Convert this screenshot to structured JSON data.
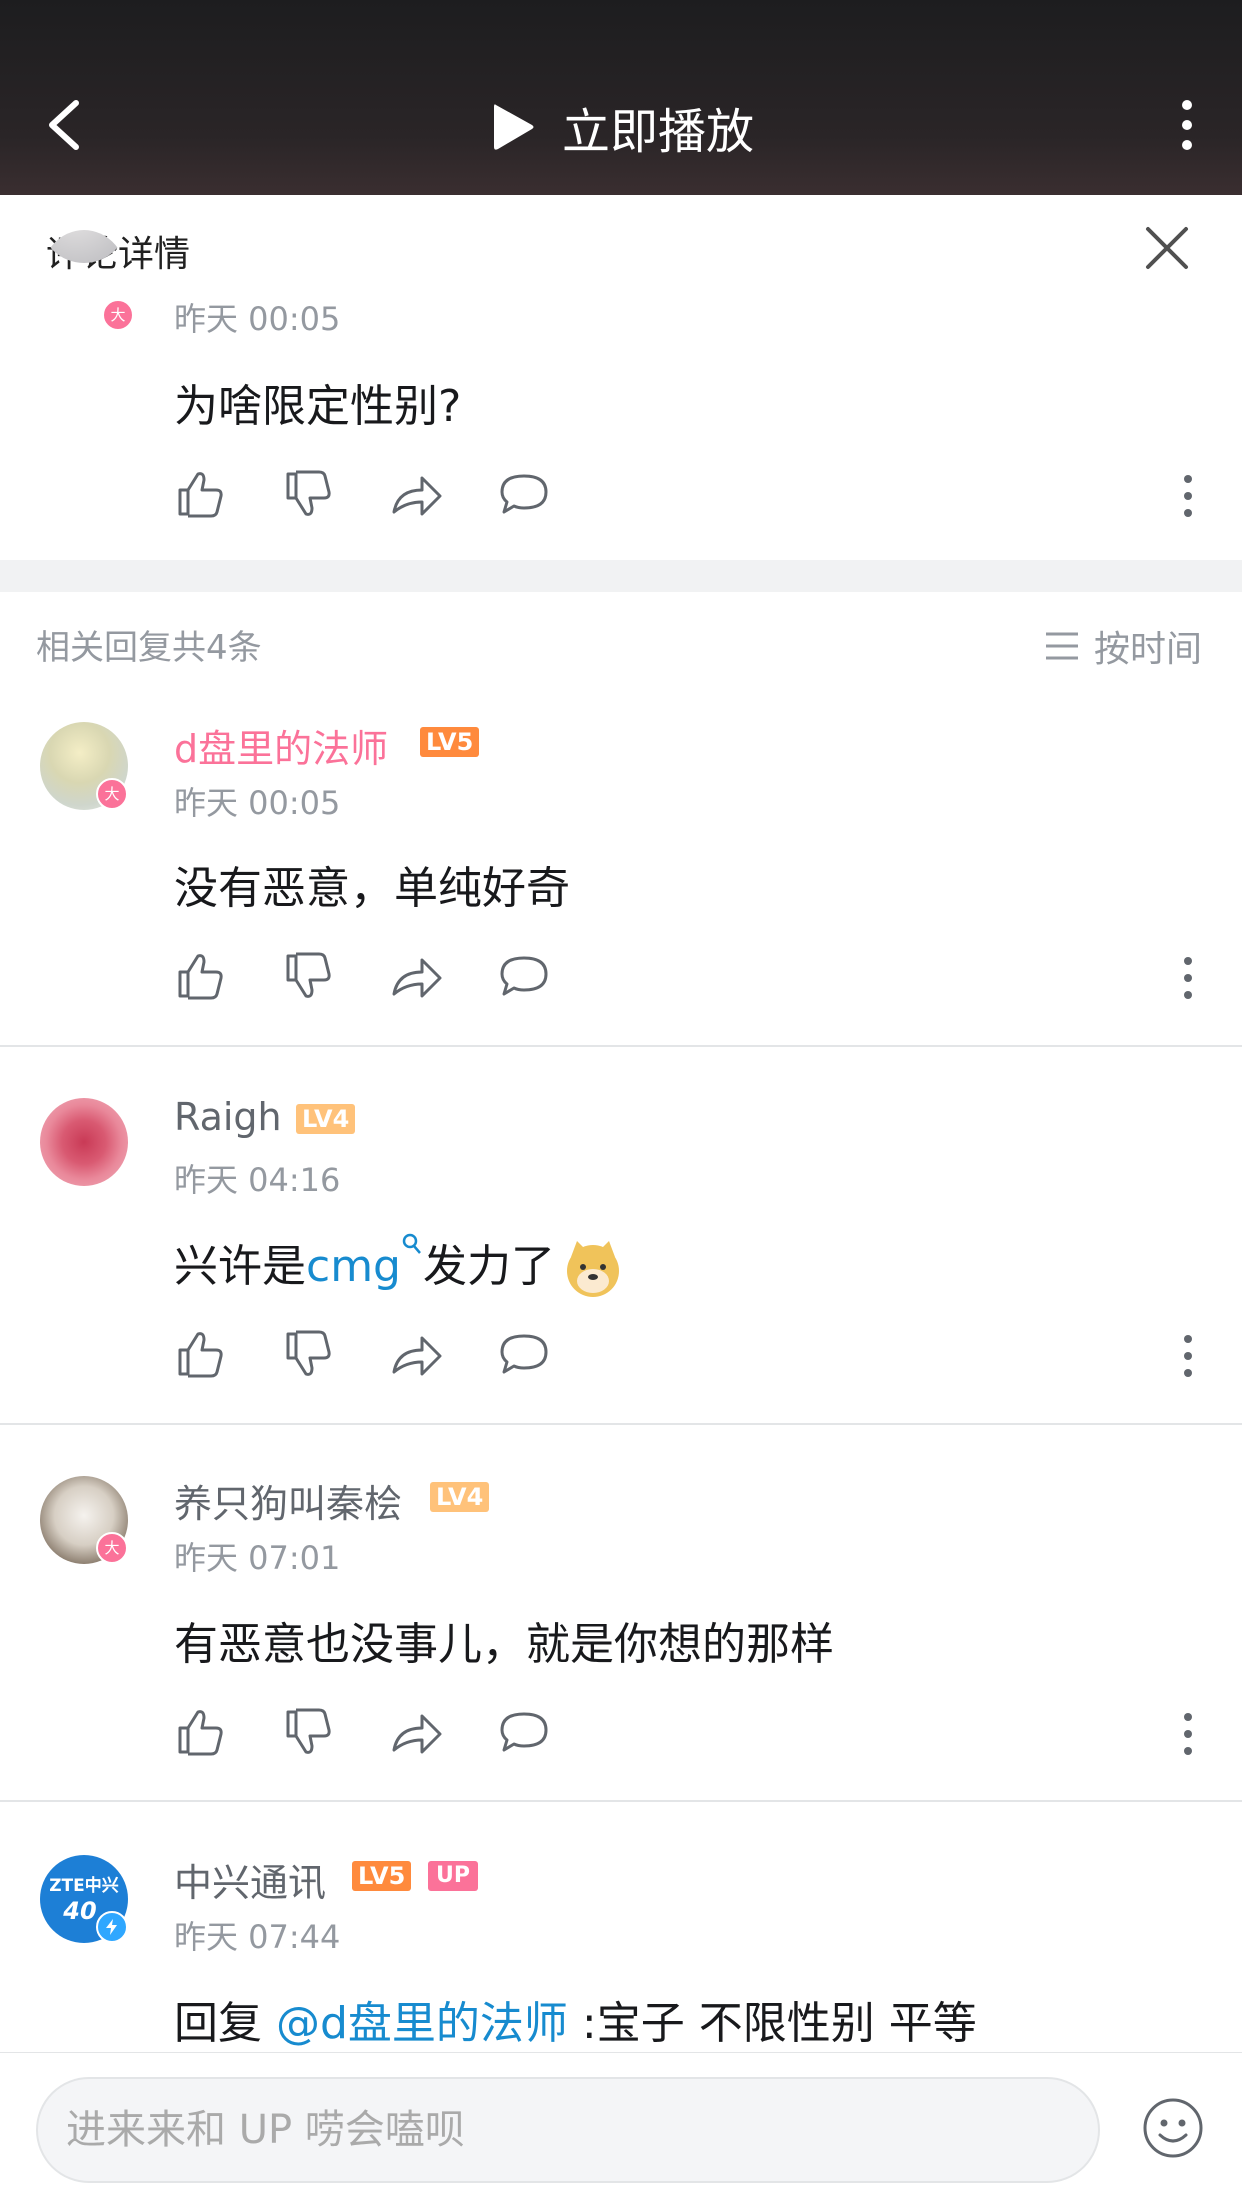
{
  "topbar": {
    "play_label": "立即播放"
  },
  "header": {
    "title": "评论详情"
  },
  "main_comment": {
    "time": "昨天 00:05",
    "content": "为啥限定性别?"
  },
  "replies_header": {
    "count_label": "相关回复共4条",
    "sort_label": "按时间"
  },
  "replies": [
    {
      "name": "d盘里的法师",
      "level": "LV5",
      "time": "昨天 00:05",
      "content": "没有恶意，单纯好奇",
      "badge": "大"
    },
    {
      "name": "Raigh",
      "level": "LV4",
      "time": "昨天 04:16",
      "content_prefix": "兴许是",
      "content_link": "cmg",
      "content_suffix": "发力了"
    },
    {
      "name": "养只狗叫秦桧",
      "level": "LV4",
      "time": "昨天 07:01",
      "content": "有恶意也没事儿，就是你想的那样",
      "badge": "大"
    },
    {
      "name": "中兴通讯",
      "level": "LV5",
      "up_tag": "UP",
      "time": "昨天 07:44",
      "content_prefix": "回复 ",
      "content_link": "@d盘里的法师",
      "content_suffix": " :宝子 不限性别 平等",
      "avatar_text": "ZTE中兴",
      "avatar_sub": "40"
    }
  ],
  "input": {
    "placeholder": "进来来和 UP 唠会嗑呗"
  },
  "colors": {
    "pink": "#fb7299",
    "link": "#178bcf",
    "lv5": "#ff8a3d",
    "lv4": "#ffc27a"
  }
}
